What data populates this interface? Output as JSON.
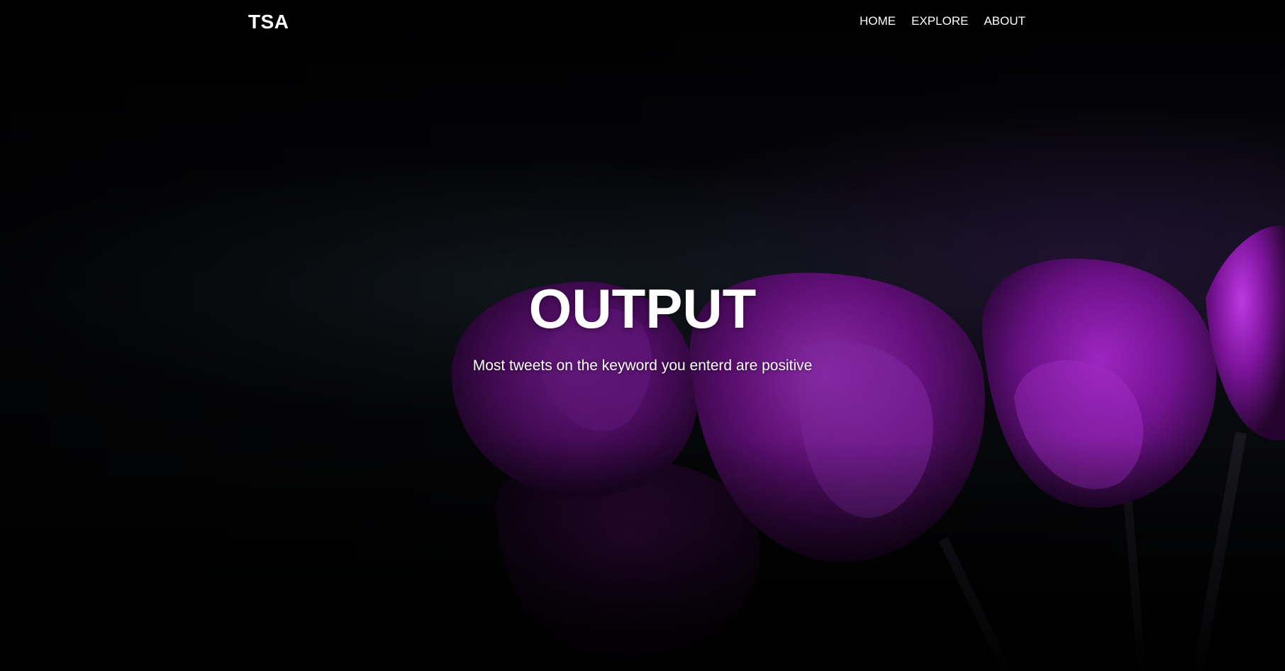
{
  "navbar": {
    "brand": "TSA",
    "links": [
      {
        "label": "HOME"
      },
      {
        "label": "EXPLORE"
      },
      {
        "label": "ABOUT"
      }
    ]
  },
  "hero": {
    "title": "OUTPUT",
    "subtitle": "Most tweets on the keyword you enterd are positive",
    "background_image": "purple-tulips",
    "accent_color": "#8a1bb0"
  }
}
